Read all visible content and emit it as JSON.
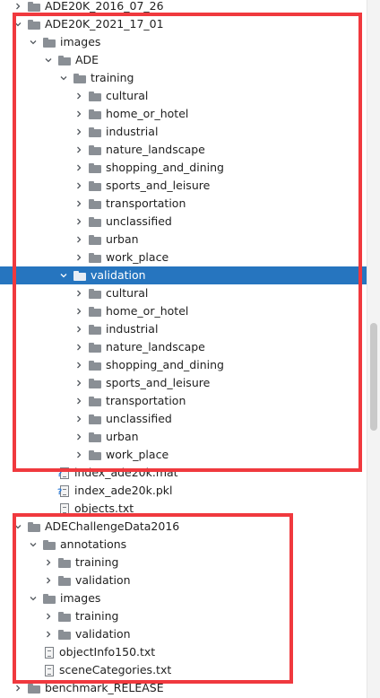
{
  "tree": {
    "rows": [
      {
        "label": "ADE20K_2016_07_26",
        "type": "folder",
        "level": 1,
        "expanded": false,
        "arrow": true
      },
      {
        "label": "ADE20K_2021_17_01",
        "type": "folder",
        "level": 1,
        "expanded": true,
        "arrow": true
      },
      {
        "label": "images",
        "type": "folder",
        "level": 2,
        "expanded": true,
        "arrow": true
      },
      {
        "label": "ADE",
        "type": "folder",
        "level": 3,
        "expanded": true,
        "arrow": true
      },
      {
        "label": "training",
        "type": "folder",
        "level": 4,
        "expanded": true,
        "arrow": true
      },
      {
        "label": "cultural",
        "type": "folder",
        "level": 5,
        "expanded": false,
        "arrow": true
      },
      {
        "label": "home_or_hotel",
        "type": "folder",
        "level": 5,
        "expanded": false,
        "arrow": true
      },
      {
        "label": "industrial",
        "type": "folder",
        "level": 5,
        "expanded": false,
        "arrow": true
      },
      {
        "label": "nature_landscape",
        "type": "folder",
        "level": 5,
        "expanded": false,
        "arrow": true
      },
      {
        "label": "shopping_and_dining",
        "type": "folder",
        "level": 5,
        "expanded": false,
        "arrow": true
      },
      {
        "label": "sports_and_leisure",
        "type": "folder",
        "level": 5,
        "expanded": false,
        "arrow": true
      },
      {
        "label": "transportation",
        "type": "folder",
        "level": 5,
        "expanded": false,
        "arrow": true
      },
      {
        "label": "unclassified",
        "type": "folder",
        "level": 5,
        "expanded": false,
        "arrow": true
      },
      {
        "label": "urban",
        "type": "folder",
        "level": 5,
        "expanded": false,
        "arrow": true
      },
      {
        "label": "work_place",
        "type": "folder",
        "level": 5,
        "expanded": false,
        "arrow": true
      },
      {
        "label": "validation",
        "type": "folder",
        "level": 4,
        "expanded": true,
        "arrow": true,
        "selected": true
      },
      {
        "label": "cultural",
        "type": "folder",
        "level": 5,
        "expanded": false,
        "arrow": true
      },
      {
        "label": "home_or_hotel",
        "type": "folder",
        "level": 5,
        "expanded": false,
        "arrow": true
      },
      {
        "label": "industrial",
        "type": "folder",
        "level": 5,
        "expanded": false,
        "arrow": true
      },
      {
        "label": "nature_landscape",
        "type": "folder",
        "level": 5,
        "expanded": false,
        "arrow": true
      },
      {
        "label": "shopping_and_dining",
        "type": "folder",
        "level": 5,
        "expanded": false,
        "arrow": true
      },
      {
        "label": "sports_and_leisure",
        "type": "folder",
        "level": 5,
        "expanded": false,
        "arrow": true
      },
      {
        "label": "transportation",
        "type": "folder",
        "level": 5,
        "expanded": false,
        "arrow": true
      },
      {
        "label": "unclassified",
        "type": "folder",
        "level": 5,
        "expanded": false,
        "arrow": true
      },
      {
        "label": "urban",
        "type": "folder",
        "level": 5,
        "expanded": false,
        "arrow": true
      },
      {
        "label": "work_place",
        "type": "folder",
        "level": 5,
        "expanded": false,
        "arrow": true
      },
      {
        "label": "index_ade20k.mat",
        "type": "file-unknown",
        "level": 3,
        "arrow": false
      },
      {
        "label": "index_ade20k.pkl",
        "type": "file-unknown",
        "level": 3,
        "arrow": false
      },
      {
        "label": "objects.txt",
        "type": "file-text",
        "level": 3,
        "arrow": false
      },
      {
        "label": "ADEChallengeData2016",
        "type": "folder",
        "level": 1,
        "expanded": true,
        "arrow": true
      },
      {
        "label": "annotations",
        "type": "folder",
        "level": 2,
        "expanded": true,
        "arrow": true
      },
      {
        "label": "training",
        "type": "folder",
        "level": 3,
        "expanded": false,
        "arrow": true
      },
      {
        "label": "validation",
        "type": "folder",
        "level": 3,
        "expanded": false,
        "arrow": true
      },
      {
        "label": "images",
        "type": "folder",
        "level": 2,
        "expanded": true,
        "arrow": true
      },
      {
        "label": "training",
        "type": "folder",
        "level": 3,
        "expanded": false,
        "arrow": true
      },
      {
        "label": "validation",
        "type": "folder",
        "level": 3,
        "expanded": false,
        "arrow": true
      },
      {
        "label": "objectInfo150.txt",
        "type": "file-text",
        "level": 2,
        "arrow": false
      },
      {
        "label": "sceneCategories.txt",
        "type": "file-text",
        "level": 2,
        "arrow": false
      },
      {
        "label": "benchmark_RELEASE",
        "type": "folder",
        "level": 1,
        "expanded": false,
        "arrow": true
      }
    ]
  },
  "colors": {
    "selection": "#2675bf",
    "highlight_box": "#f0393e",
    "folder_icon": "#8a8f95"
  },
  "icons": {
    "expanded": "chevron-down-icon",
    "collapsed": "chevron-right-icon",
    "folder": "folder-icon",
    "file_text": "text-file-icon",
    "file_unknown": "unknown-file-icon"
  }
}
